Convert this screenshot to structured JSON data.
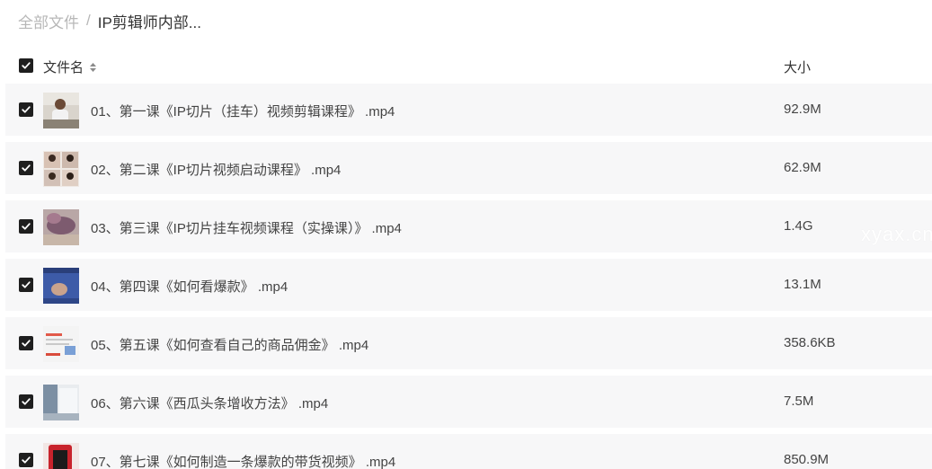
{
  "breadcrumb": {
    "root": "全部文件",
    "separator": "/",
    "current": "IP剪辑师内部..."
  },
  "header": {
    "name_label": "文件名",
    "size_label": "大小",
    "sort_icon": "sort-updown-icon"
  },
  "files": [
    {
      "name": "01、第一课《IP切片（挂车）视频剪辑课程》 .mp4",
      "size": "92.9M",
      "thumb": "person-at-desk",
      "checked": true
    },
    {
      "name": "02、第二课《IP切片视频启动课程》 .mp4",
      "size": "62.9M",
      "thumb": "people-grid",
      "checked": true
    },
    {
      "name": "03、第三课《IP切片挂车视频课程（实操课）》 .mp4",
      "size": "1.4G",
      "thumb": "hand-closeup",
      "checked": true
    },
    {
      "name": "04、第四课《如何看爆款》 .mp4",
      "size": "13.1M",
      "thumb": "phone-screen",
      "checked": true
    },
    {
      "name": "05、第五课《如何查看自己的商品佣金》 .mp4",
      "size": "358.6KB",
      "thumb": "web-screenshot",
      "checked": true
    },
    {
      "name": "06、第六课《西瓜头条增收方法》 .mp4",
      "size": "7.5M",
      "thumb": "whiteboard",
      "checked": true
    },
    {
      "name": "07、第七课《如何制造一条爆款的带货视频》 .mp4",
      "size": "850.9M",
      "thumb": "red-product",
      "checked": true
    }
  ],
  "watermark": "xyax.cn",
  "colors": {
    "row_bg": "#f7f7f8",
    "checkbox": "#1f1f1f",
    "breadcrumb_muted": "#b7b7b7",
    "text": "#444444"
  }
}
